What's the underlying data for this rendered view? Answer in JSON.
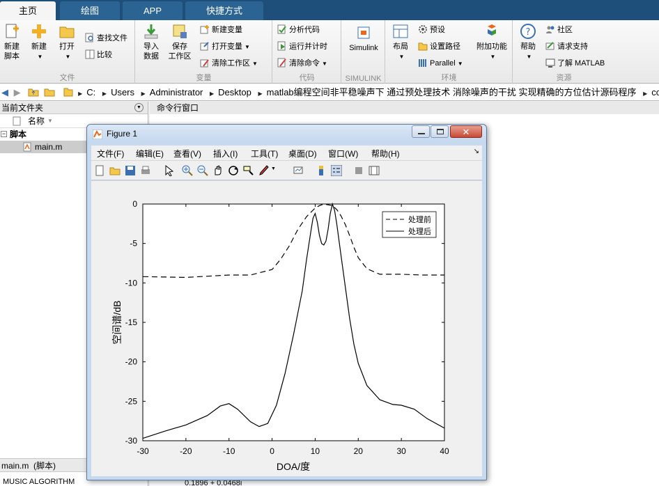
{
  "tabs": [
    {
      "label": "主页",
      "active": true
    },
    {
      "label": "绘图",
      "active": false
    },
    {
      "label": "APP",
      "active": false
    },
    {
      "label": "快捷方式",
      "active": false
    }
  ],
  "ribbon": {
    "file": {
      "group_label": "文件",
      "new_script": "新建\n脚本",
      "new": "新建",
      "open": "打开",
      "find_files": "查找文件",
      "compare": "比较"
    },
    "variable": {
      "group_label": "变量",
      "import": "导入\n数据",
      "save_ws": "保存\n工作区",
      "new_var": "新建变量",
      "open_var": "打开变量",
      "clear_ws": "清除工作区"
    },
    "code": {
      "group_label": "代码",
      "analyze": "分析代码",
      "run_time": "运行并计时",
      "clear_cmd": "清除命令"
    },
    "simulink": {
      "group_label": "SIMULINK",
      "simulink": "Simulink"
    },
    "env": {
      "group_label": "环境",
      "layout": "布局",
      "prefs": "预设",
      "set_path": "设置路径",
      "parallel": "Parallel",
      "addons": "附加功能"
    },
    "resources": {
      "group_label": "资源",
      "help": "帮助",
      "community": "社区",
      "support": "请求支持",
      "learn": "了解 MATLAB"
    }
  },
  "address": {
    "crumbs": [
      "C:",
      "Users",
      "Administrator",
      "Desktop",
      "matlab编程空间非平稳噪声下 通过预处理技术 消除噪声的干扰 实现精确的方位估计源码程序",
      "code"
    ]
  },
  "left_panel": {
    "title": "当前文件夹",
    "column": "名称",
    "folder": "脚本",
    "file": "main.m",
    "details": "main.m  (脚本)",
    "bottom_text": "MUSIC ALGORITHM"
  },
  "command_window": {
    "title": "命令行窗口",
    "bottom_text": "0.1896 + 0.0468i"
  },
  "figure": {
    "title": "Figure 1",
    "menus": [
      "文件(F)",
      "编辑(E)",
      "查看(V)",
      "插入(I)",
      "工具(T)",
      "桌面(D)",
      "窗口(W)",
      "帮助(H)"
    ]
  },
  "chart_data": {
    "type": "line",
    "xlabel": "DOA/度",
    "ylabel": "空间谱/dB",
    "xlim": [
      -30,
      40
    ],
    "ylim": [
      -30,
      0
    ],
    "xticks": [
      -30,
      -20,
      -10,
      0,
      10,
      20,
      30,
      40
    ],
    "yticks": [
      0,
      -5,
      -10,
      -15,
      -20,
      -25,
      -30
    ],
    "legend_position": "top-right",
    "grid": false,
    "series": [
      {
        "name": "处理前",
        "style": "dashed",
        "color": "#000000",
        "x": [
          -30,
          -20,
          -10,
          -5,
          0,
          2,
          4,
          6,
          8,
          10,
          11,
          12,
          13,
          14,
          15,
          16,
          17,
          18,
          19,
          20,
          22,
          25,
          30,
          35,
          40
        ],
        "y": [
          -9.2,
          -9.3,
          -9.0,
          -9.0,
          -8.3,
          -7.0,
          -5.3,
          -3.2,
          -1.6,
          -0.5,
          -0.2,
          0,
          -0.1,
          -0.2,
          -0.7,
          -1.5,
          -2.6,
          -4.0,
          -5.5,
          -6.8,
          -8.2,
          -8.9,
          -8.9,
          -9.0,
          -9.0
        ]
      },
      {
        "name": "处理后",
        "style": "solid",
        "color": "#000000",
        "x": [
          -30,
          -25,
          -20,
          -15,
          -12,
          -10,
          -8,
          -5,
          -3,
          -1,
          1,
          3,
          5,
          7,
          8,
          9,
          9.5,
          10,
          10.5,
          11,
          11.5,
          12,
          12.5,
          13,
          13.5,
          14,
          14.5,
          15,
          16,
          17,
          18,
          19,
          20,
          22,
          25,
          28,
          30,
          33,
          36,
          40
        ],
        "y": [
          -29.7,
          -28.8,
          -28.0,
          -26.8,
          -25.6,
          -25.3,
          -26.0,
          -27.6,
          -28.2,
          -27.8,
          -25.5,
          -21.5,
          -16.5,
          -11.0,
          -7.0,
          -3.5,
          -1.8,
          -1.2,
          -2.3,
          -4.0,
          -5.0,
          -5.2,
          -4.7,
          -3.2,
          -1.2,
          0,
          -0.8,
          -2.5,
          -6.5,
          -10.5,
          -14.5,
          -17.8,
          -20.2,
          -23.0,
          -24.8,
          -25.4,
          -25.5,
          -26.0,
          -27.2,
          -28.4
        ]
      }
    ]
  }
}
